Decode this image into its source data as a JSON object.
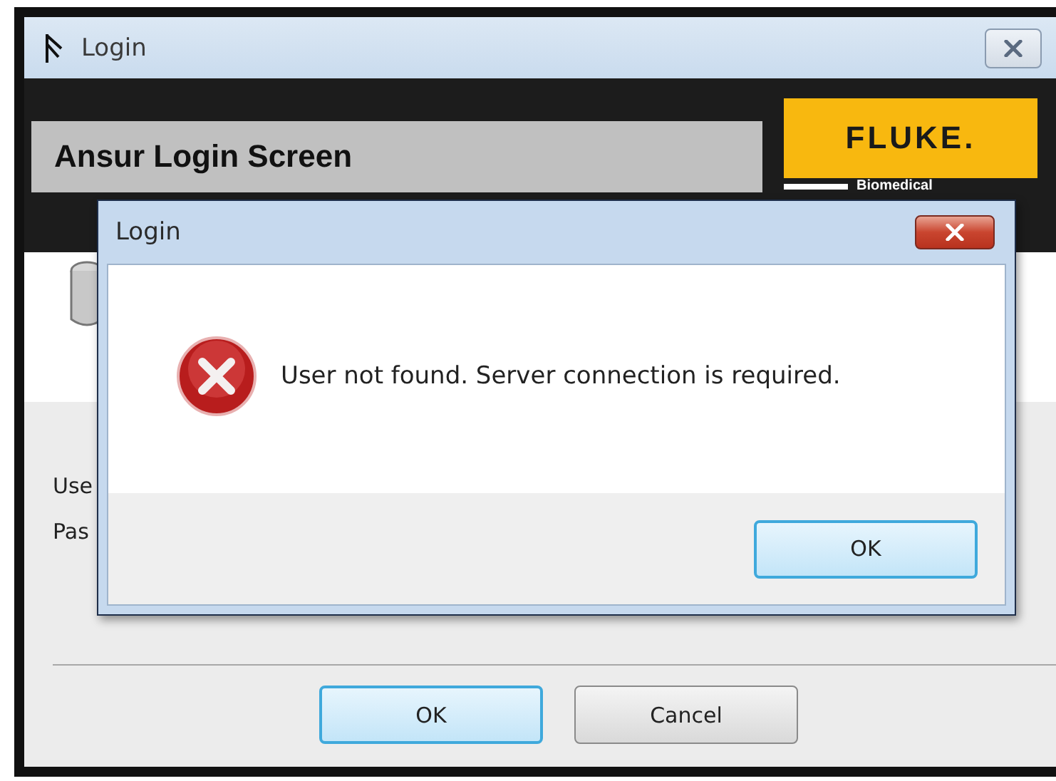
{
  "window": {
    "title": "Login"
  },
  "header": {
    "title": "Ansur Login Screen",
    "logo": "FLUKE.",
    "logo_subtitle": "Biomedical"
  },
  "form": {
    "labels": [
      "Use",
      "Pas"
    ]
  },
  "buttons": [
    {
      "label": "OK",
      "default": true
    },
    {
      "label": "Cancel",
      "default": false
    }
  ],
  "dialog": {
    "title": "Login",
    "kind": "error",
    "message": "User not found. Server connection is required.",
    "buttons": [
      {
        "label": "OK",
        "default": true
      }
    ]
  }
}
